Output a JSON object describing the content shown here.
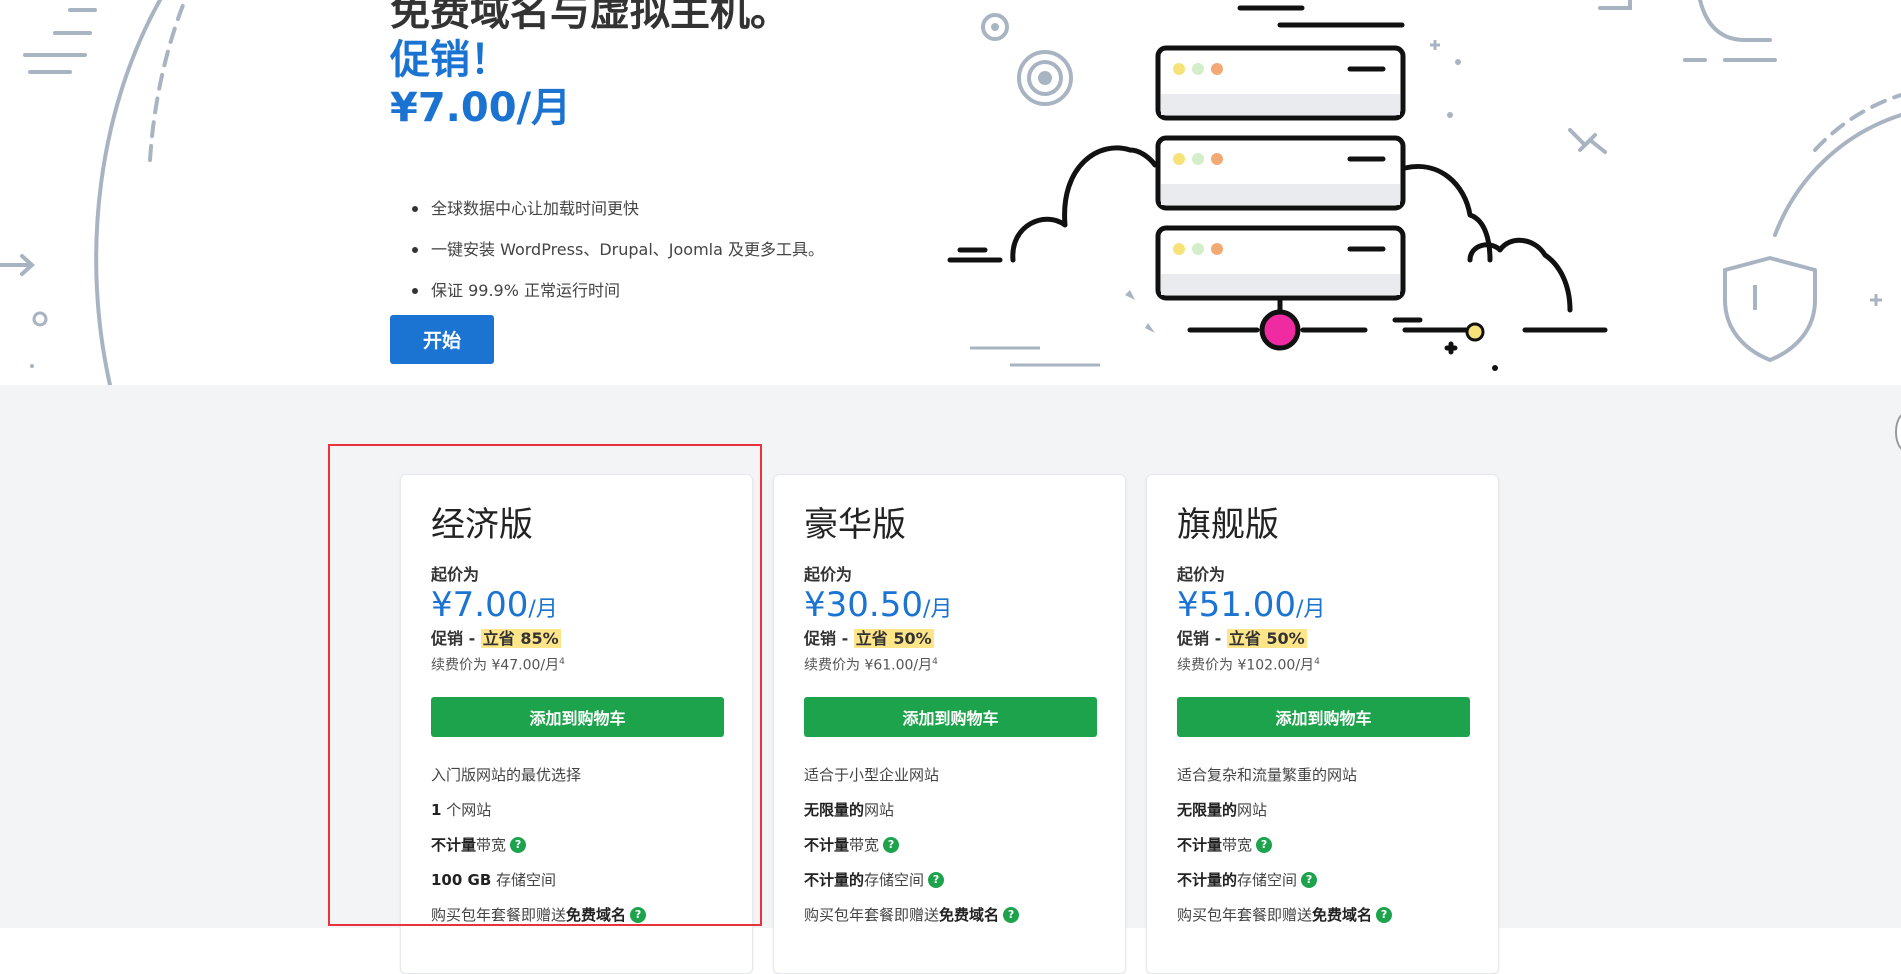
{
  "hero": {
    "heading": "免费域名与虚拟主机。",
    "promo": "促销！",
    "price": "¥7.00/月",
    "bullets": [
      "全球数据中心让加载时间更快",
      "一键安装 WordPress、Drupal、Joomla 及更多工具。",
      "保证 99.9% 正常运行时间"
    ],
    "cta_label": "开始"
  },
  "plans": [
    {
      "name": "经济版",
      "from_label": "起价为",
      "price": "¥7.00",
      "per": "/月",
      "sale_label": "促销 - ",
      "save": "立省 85%",
      "renew": "续费价为 ¥47.00/月",
      "footnote": "4",
      "cart_label": "添加到购物车",
      "desc": "入门版网站的最优选择",
      "websites_strong": "1",
      "websites_rest": " 个网站",
      "bandwidth_strong": "不计量",
      "bandwidth_rest": "带宽",
      "storage_strong": "100 GB",
      "storage_rest": " 存储空间",
      "domain_rest": "购买包年套餐即赠送",
      "domain_strong": "免费域名"
    },
    {
      "name": "豪华版",
      "from_label": "起价为",
      "price": "¥30.50",
      "per": "/月",
      "sale_label": "促销 - ",
      "save": "立省 50%",
      "renew": "续费价为 ¥61.00/月",
      "footnote": "4",
      "cart_label": "添加到购物车",
      "desc": "适合于小型企业网站",
      "websites_strong": "无限量的",
      "websites_rest": "网站",
      "bandwidth_strong": "不计量",
      "bandwidth_rest": "带宽",
      "storage_strong": "不计量的",
      "storage_rest": "存储空间",
      "domain_rest": "购买包年套餐即赠送",
      "domain_strong": "免费域名"
    },
    {
      "name": "旗舰版",
      "from_label": "起价为",
      "price": "¥51.00",
      "per": "/月",
      "sale_label": "促销 - ",
      "save": "立省 50%",
      "renew": "续费价为 ¥102.00/月",
      "footnote": "4",
      "cart_label": "添加到购物车",
      "desc": "适合复杂和流量繁重的网站",
      "websites_strong": "无限量的",
      "websites_rest": "网站",
      "bandwidth_strong": "不计量",
      "bandwidth_rest": "带宽",
      "storage_strong": "不计量的",
      "storage_rest": "存储空间",
      "domain_rest": "购买包年套餐即赠送",
      "domain_strong": "免费域名"
    }
  ],
  "help_glyph": "?",
  "colors": {
    "brand_blue": "#1b73d2",
    "cart_green": "#1ea34d",
    "save_yellow": "#ffe58a",
    "highlight_red": "#e8333a",
    "section_bg": "#f3f4f6"
  },
  "icons": [
    "server-stack-illustration",
    "cloud-illustration",
    "shield-icon",
    "arrow-right-icon",
    "help-icon"
  ]
}
